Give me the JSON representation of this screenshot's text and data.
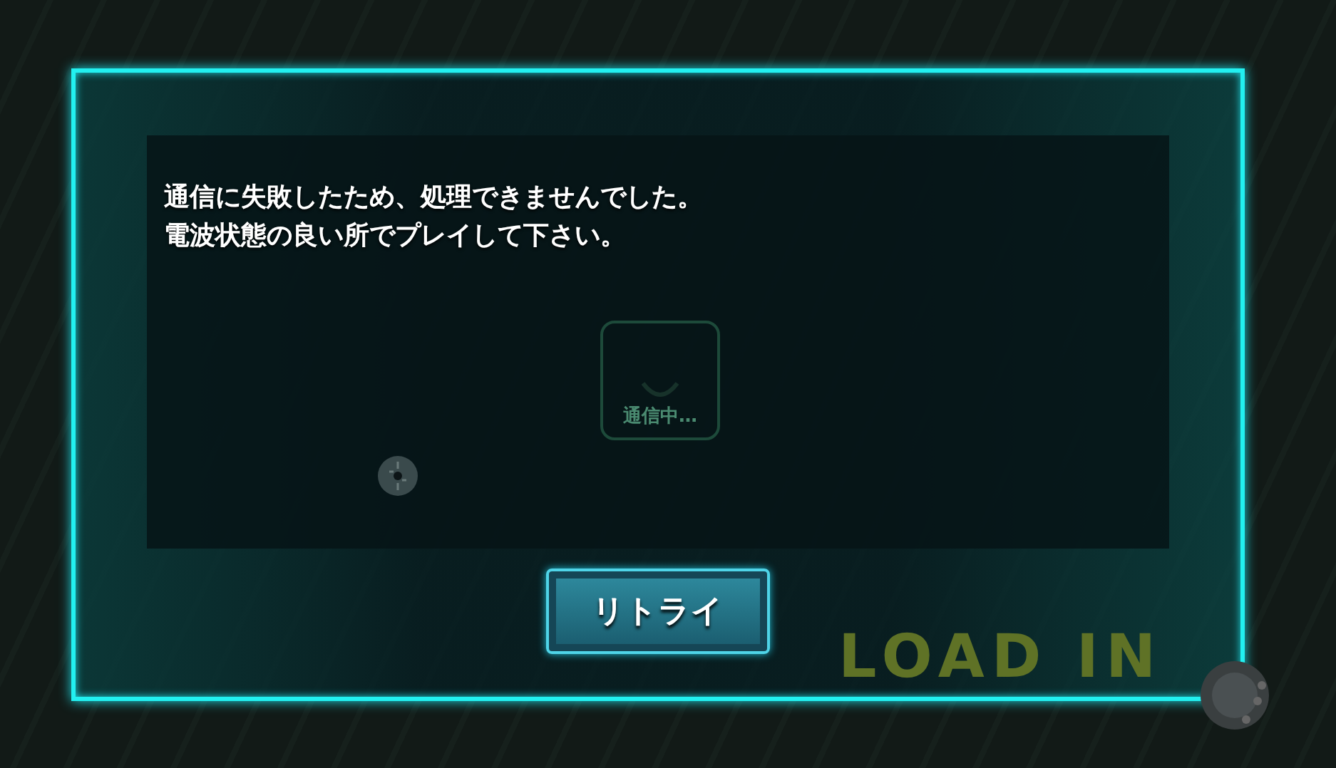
{
  "background": {
    "loading_text": "LOAD IN"
  },
  "dialog": {
    "message": [
      "通信に失敗したため、処理できませんでした。",
      "電波状態の良い所でプレイして下さい。"
    ],
    "indicator": {
      "label": "通信中…"
    },
    "buttons": [
      {
        "label": "リトライ"
      }
    ]
  }
}
